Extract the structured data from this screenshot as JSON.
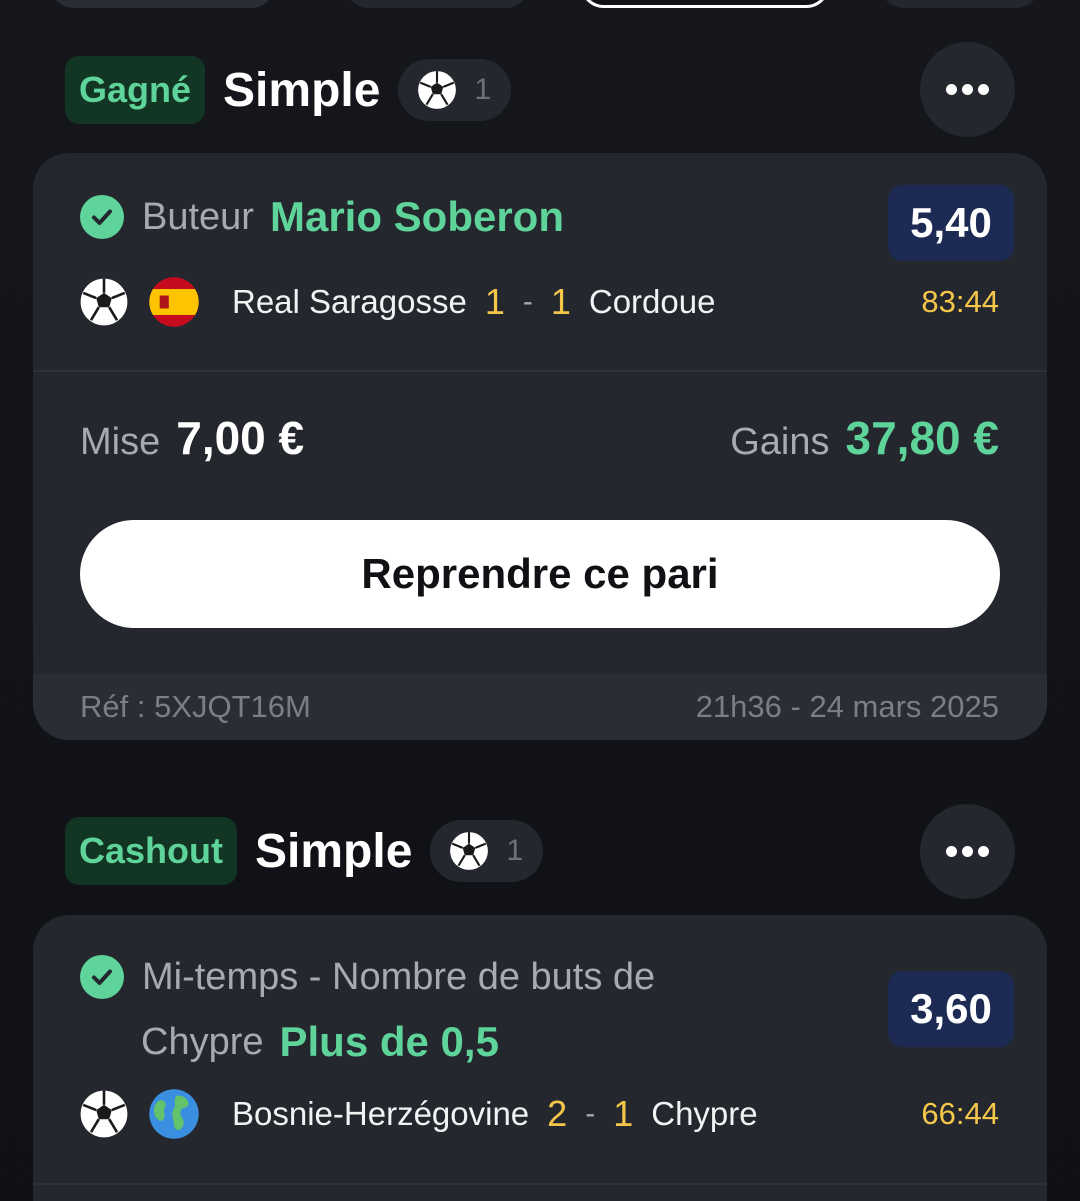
{
  "bets": [
    {
      "status": "Gagné",
      "type": "Simple",
      "selection_count": "1",
      "selection_label": "Buteur",
      "selection_value": "Mario Soberon",
      "odds": "5,40",
      "home_team": "Real Saragosse",
      "home_score": "1",
      "away_score": "1",
      "away_team": "Cordoue",
      "clock": "83:44",
      "stake_label": "Mise",
      "stake": "7,00 €",
      "gains_label": "Gains",
      "gains": "37,80 €",
      "rebet_label": "Reprendre ce pari",
      "reference": "Réf : 5XJQT16M",
      "date": "21h36 - 24 mars 2025",
      "competition_flag": "spain-flag-icon"
    },
    {
      "status": "Cashout",
      "type": "Simple",
      "selection_count": "1",
      "selection_label_line1": "Mi-temps - Nombre de buts de",
      "selection_label_line2": "Chypre",
      "selection_value": "Plus de 0,5",
      "odds": "3,60",
      "home_team": "Bosnie-Herzégovine",
      "home_score": "2",
      "away_score": "1",
      "away_team": "Chypre",
      "clock": "66:44",
      "competition_flag": "globe-icon"
    }
  ],
  "colors": {
    "background": "#121419",
    "card": "#24272d",
    "win_green": "#5fd49a",
    "badge_bg": "#133624",
    "score_yellow": "#f4c74a",
    "odds_bg": "#1c2a54"
  }
}
